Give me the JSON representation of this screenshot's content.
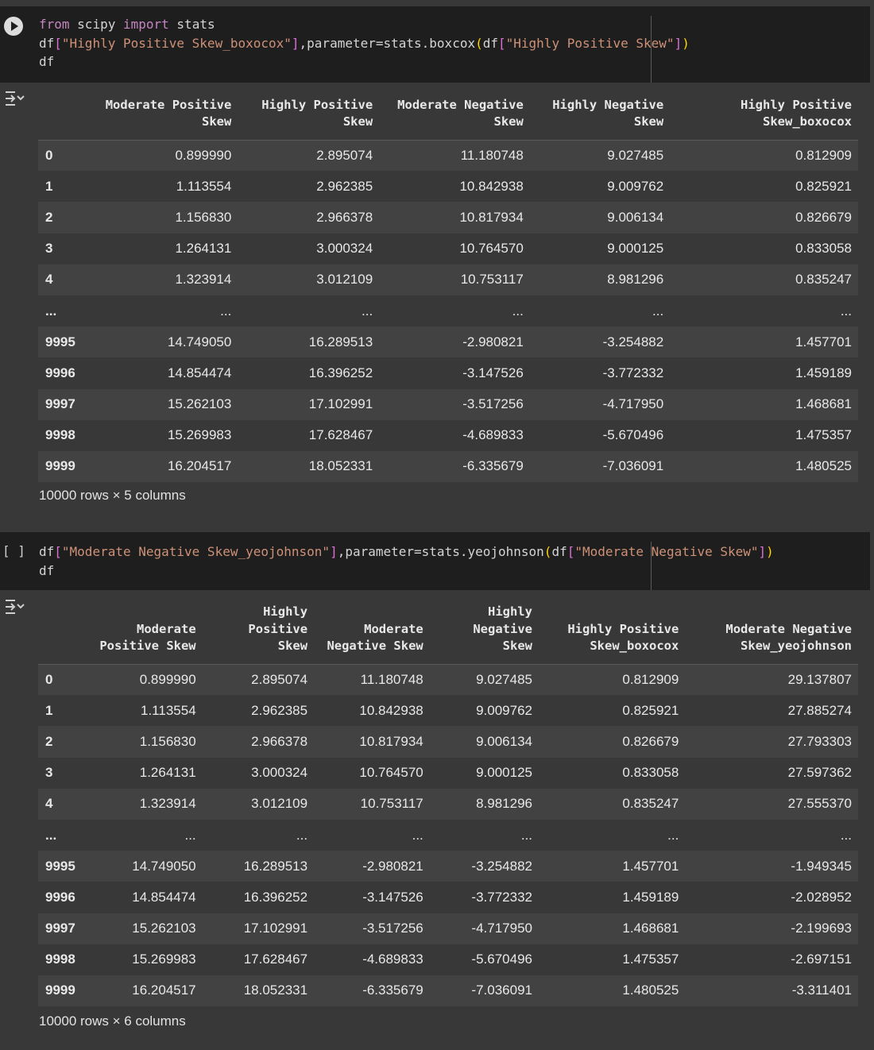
{
  "cell1": {
    "line1": {
      "kw1": "from",
      "mod": "scipy",
      "kw2": "import",
      "name": "stats"
    },
    "line2": {
      "a": "df",
      "b": "[",
      "c": "\"Highly Positive Skew_boxocox\"",
      "d": "]",
      "e": ",parameter=stats.boxcox",
      "f": "(",
      "g": "df",
      "h": "[",
      "i": "\"Highly Positive Skew\"",
      "j": "]",
      "k": ")"
    },
    "line3": "df",
    "output": {
      "columns": [
        [
          "Moderate Positive",
          "Skew"
        ],
        [
          "Highly Positive",
          "Skew"
        ],
        [
          "Moderate Negative",
          "Skew"
        ],
        [
          "Highly Negative",
          "Skew"
        ],
        [
          "Highly Positive",
          "Skew_boxocox"
        ]
      ],
      "rows": [
        [
          "0",
          "0.899990",
          "2.895074",
          "11.180748",
          "9.027485",
          "0.812909"
        ],
        [
          "1",
          "1.113554",
          "2.962385",
          "10.842938",
          "9.009762",
          "0.825921"
        ],
        [
          "2",
          "1.156830",
          "2.966378",
          "10.817934",
          "9.006134",
          "0.826679"
        ],
        [
          "3",
          "1.264131",
          "3.000324",
          "10.764570",
          "9.000125",
          "0.833058"
        ],
        [
          "4",
          "1.323914",
          "3.012109",
          "10.753117",
          "8.981296",
          "0.835247"
        ],
        [
          "...",
          "...",
          "...",
          "...",
          "...",
          "..."
        ],
        [
          "9995",
          "14.749050",
          "16.289513",
          "-2.980821",
          "-3.254882",
          "1.457701"
        ],
        [
          "9996",
          "14.854474",
          "16.396252",
          "-3.147526",
          "-3.772332",
          "1.459189"
        ],
        [
          "9997",
          "15.262103",
          "17.102991",
          "-3.517256",
          "-4.717950",
          "1.468681"
        ],
        [
          "9998",
          "15.269983",
          "17.628467",
          "-4.689833",
          "-5.670496",
          "1.475357"
        ],
        [
          "9999",
          "16.204517",
          "18.052331",
          "-6.335679",
          "-7.036091",
          "1.480525"
        ]
      ],
      "shape": "10000 rows × 5 columns"
    }
  },
  "cell2": {
    "exec_bracket": "[ ]",
    "line1": {
      "a": "df",
      "b": "[",
      "c": "\"Moderate Negative Skew_yeojohnson\"",
      "d": "]",
      "e": ",parameter=stats.yeojohnson",
      "f": "(",
      "g": "df",
      "h": "[",
      "i": "\"Moderate Negative Skew\"",
      "j": "]",
      "k": ")"
    },
    "line2": "df",
    "output": {
      "columns": [
        [
          "Moderate",
          "Positive Skew"
        ],
        [
          "Highly",
          "Positive",
          "Skew"
        ],
        [
          "Moderate",
          "Negative Skew"
        ],
        [
          "Highly",
          "Negative",
          "Skew"
        ],
        [
          "Highly Positive",
          "Skew_boxocox"
        ],
        [
          "Moderate Negative",
          "Skew_yeojohnson"
        ]
      ],
      "rows": [
        [
          "0",
          "0.899990",
          "2.895074",
          "11.180748",
          "9.027485",
          "0.812909",
          "29.137807"
        ],
        [
          "1",
          "1.113554",
          "2.962385",
          "10.842938",
          "9.009762",
          "0.825921",
          "27.885274"
        ],
        [
          "2",
          "1.156830",
          "2.966378",
          "10.817934",
          "9.006134",
          "0.826679",
          "27.793303"
        ],
        [
          "3",
          "1.264131",
          "3.000324",
          "10.764570",
          "9.000125",
          "0.833058",
          "27.597362"
        ],
        [
          "4",
          "1.323914",
          "3.012109",
          "10.753117",
          "8.981296",
          "0.835247",
          "27.555370"
        ],
        [
          "...",
          "...",
          "...",
          "...",
          "...",
          "...",
          "..."
        ],
        [
          "9995",
          "14.749050",
          "16.289513",
          "-2.980821",
          "-3.254882",
          "1.457701",
          "-1.949345"
        ],
        [
          "9996",
          "14.854474",
          "16.396252",
          "-3.147526",
          "-3.772332",
          "1.459189",
          "-2.028952"
        ],
        [
          "9997",
          "15.262103",
          "17.102991",
          "-3.517256",
          "-4.717950",
          "1.468681",
          "-2.199693"
        ],
        [
          "9998",
          "15.269983",
          "17.628467",
          "-4.689833",
          "-5.670496",
          "1.475357",
          "-2.697151"
        ],
        [
          "9999",
          "16.204517",
          "18.052331",
          "-6.335679",
          "-7.036091",
          "1.480525",
          "-3.311401"
        ]
      ],
      "shape": "10000 rows × 6 columns"
    }
  }
}
